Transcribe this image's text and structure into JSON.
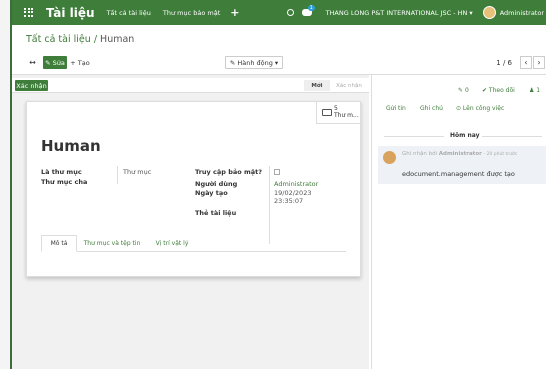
{
  "topbar": {
    "brand": "Tài liệu",
    "menu": [
      "Tất cả tài liệu",
      "Thư mục bảo mật"
    ],
    "plus": "+",
    "chat_badge": "1",
    "company": "THANG LONG P&T INTERNATIONAL JSC - HN",
    "company_caret": "▾",
    "user": "Administrator"
  },
  "control": {
    "breadcrumb_parent": "Tất cả tài liệu",
    "breadcrumb_sep": " / ",
    "breadcrumb_current": "Human",
    "collapse_label": "↔",
    "edit_label": "✎ Sửa",
    "create_label": "+ Tạo",
    "action_label": "✎ Hành động ▾",
    "pager": "1 / 6",
    "prev": "‹",
    "next": "›"
  },
  "statusbar": {
    "confirm_label": "Xác nhận",
    "stages": [
      "Mới",
      "Xác nhận"
    ]
  },
  "sheet": {
    "smart_count": "5",
    "smart_label": "Thư m...",
    "title": "Human",
    "fields": {
      "is_folder_label": "Là thư mục",
      "is_folder_value": "Thư mục",
      "parent_label": "Thư mục cha",
      "security_label": "Truy cập bảo mật?",
      "user_label": "Người dùng",
      "user_value": "Administrator",
      "date_label": "Ngày tạo",
      "date_value": "19/02/2023",
      "time_value": "23:35:07",
      "tags_label": "Thẻ tài liệu"
    },
    "tabs": [
      "Mô tả",
      "Thư mục và tệp tin",
      "Vị trí vật lý"
    ]
  },
  "chatter": {
    "attachments": "0",
    "follow_label": "✔ Theo dõi",
    "followers": "1",
    "actions": [
      "Gửi tin",
      "Ghi chú",
      "⊙ Lên công việc"
    ],
    "today": "Hôm nay",
    "message": {
      "prefix": "Ghi nhận bởi",
      "author": "Administrator",
      "time": "- 20 phút trước",
      "body": "edocument.management được tạo"
    }
  },
  "colors": {
    "brand_green": "#3e7d3a",
    "message_bg": "#eef2f6"
  }
}
